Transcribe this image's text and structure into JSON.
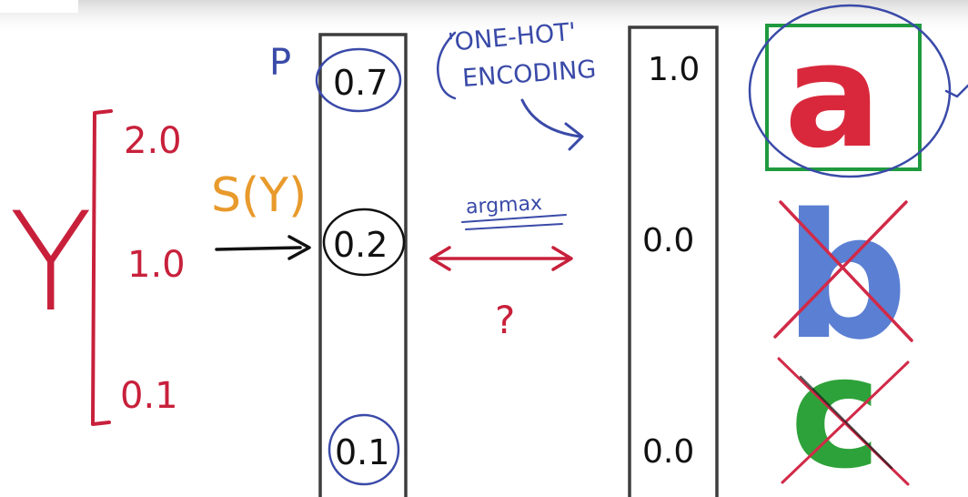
{
  "colors": {
    "background_top": "#e9e9ea",
    "ink_red": "#c8203b",
    "ink_blue": "#3a4aa8",
    "ink_orange": "#e89a2c",
    "ink_black": "#111111",
    "box_gray": "#3d3d3d",
    "frame_green": "#1f9a3f",
    "letter_a_red": "#d9283c",
    "letter_b_blue": "#5a7fd3",
    "letter_c_green": "#2ea23a",
    "cross_red": "#d12a48"
  },
  "logits": {
    "label": "Y",
    "values": [
      "2.0",
      "1.0",
      "0.1"
    ]
  },
  "softmax": {
    "label": "S(Y)",
    "arrow": "——>"
  },
  "probabilities": {
    "label": "P",
    "values": [
      "0.7",
      "0.2",
      "0.1"
    ]
  },
  "onehot": {
    "title_line1": "'ONE-HOT'",
    "title_line2": "ENCODING",
    "values": [
      "1.0",
      "0.0",
      "0.0"
    ]
  },
  "argmax": {
    "label": "argmax",
    "question": "?"
  },
  "classes": [
    {
      "letter": "a",
      "selected": true
    },
    {
      "letter": "b",
      "selected": false
    },
    {
      "letter": "c",
      "selected": false
    }
  ]
}
